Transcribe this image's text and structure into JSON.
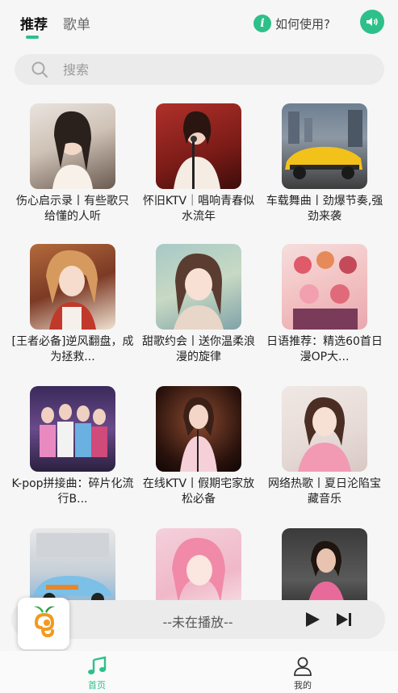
{
  "header": {
    "tabs": [
      "推荐",
      "歌单"
    ],
    "help_label": "如何使用?",
    "help_icon": "info-icon",
    "speaker_icon": "speaker-icon",
    "accent": "#2ec08a"
  },
  "search": {
    "placeholder": "搜索"
  },
  "playlists": [
    {
      "title": "伤心启示录丨有些歌只给懂的人听"
    },
    {
      "title": "怀旧KTV｜唱响青春似水流年"
    },
    {
      "title": "车载舞曲丨劲爆节奏,强劲来袭"
    },
    {
      "title": "[王者必备]逆风翻盘，成为拯救..."
    },
    {
      "title": "甜歌约会丨送你温柔浪漫的旋律"
    },
    {
      "title": "日语推荐：精选60首日漫OP大..."
    },
    {
      "title": "K-pop拼接曲：碎片化流行B..."
    },
    {
      "title": "在线KTV丨假期宅家放松必备"
    },
    {
      "title": "网络热歌丨夏日沦陷宝藏音乐"
    },
    {
      "title": ""
    },
    {
      "title": ""
    },
    {
      "title": ""
    }
  ],
  "player": {
    "status": "--未在播放--",
    "play_icon": "play-icon",
    "next_icon": "next-icon"
  },
  "nav": {
    "home_label": "首页",
    "mine_label": "我的"
  }
}
